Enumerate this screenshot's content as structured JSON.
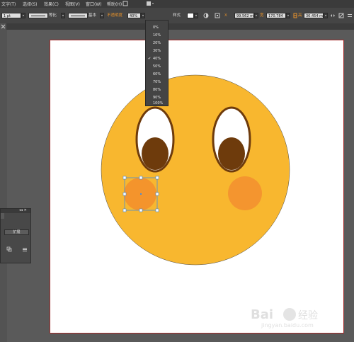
{
  "menu": [
    "文字(T)",
    "选择(S)",
    "效果(C)",
    "视图(V)",
    "窗口(W)",
    "帮助(H)"
  ],
  "toolbar": {
    "stroke_weight": "1 pt",
    "profile_label": "等比",
    "brush_label": "基本",
    "opacity_label": "不透明度",
    "opacity_value": "40%",
    "style_label": "样式",
    "x_value": "99.562 m",
    "w_value": "170.784",
    "h_value": "36.454 m"
  },
  "opacity_menu": {
    "options": [
      "0%",
      "10%",
      "20%",
      "30%",
      "40%",
      "50%",
      "60%",
      "70%",
      "80%",
      "90%",
      "100%"
    ],
    "selected": "40%",
    "check_mark": "✔"
  },
  "panel": {
    "controls": "◂◂ ✕",
    "button_label": "扩展"
  },
  "colors": {
    "face": "#f8b72f",
    "eye_outline": "#6e3b0c",
    "pupil": "#6e3b0c",
    "cheek_left": "#f4942c",
    "cheek_right": "#f4952f",
    "selection": "#4a8cd8",
    "artboard_border": "#a52a2a"
  }
}
